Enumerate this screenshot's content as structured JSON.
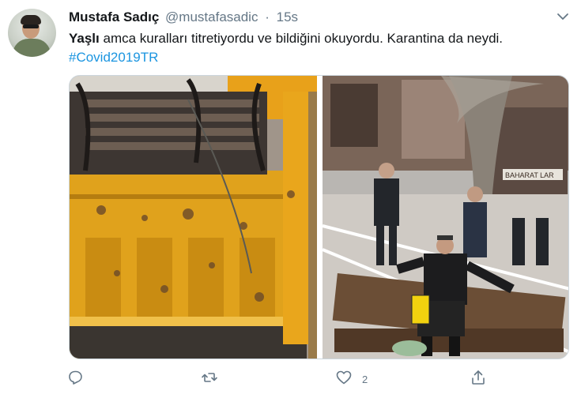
{
  "tweet": {
    "display_name": "Mustafa Sadıç",
    "handle": "@mustafasadic",
    "separator": "·",
    "time": "15s",
    "text_bold": "Yaşlı",
    "text_rest": " amca kuralları titretiyordu ve bildiğini okuyordu. Karantina da neydi.",
    "hashtag": "#Covid2019TR",
    "accent_color": "#1b95e0"
  },
  "media": {
    "left_image": "truck-with-benches",
    "right_image": "man-on-bench-with-tape",
    "sign_label": "BAHARAT LAR"
  },
  "actions": {
    "reply_icon": "reply-icon",
    "retweet_icon": "retweet-icon",
    "like_icon": "heart-icon",
    "like_count": "2",
    "share_icon": "share-icon"
  }
}
